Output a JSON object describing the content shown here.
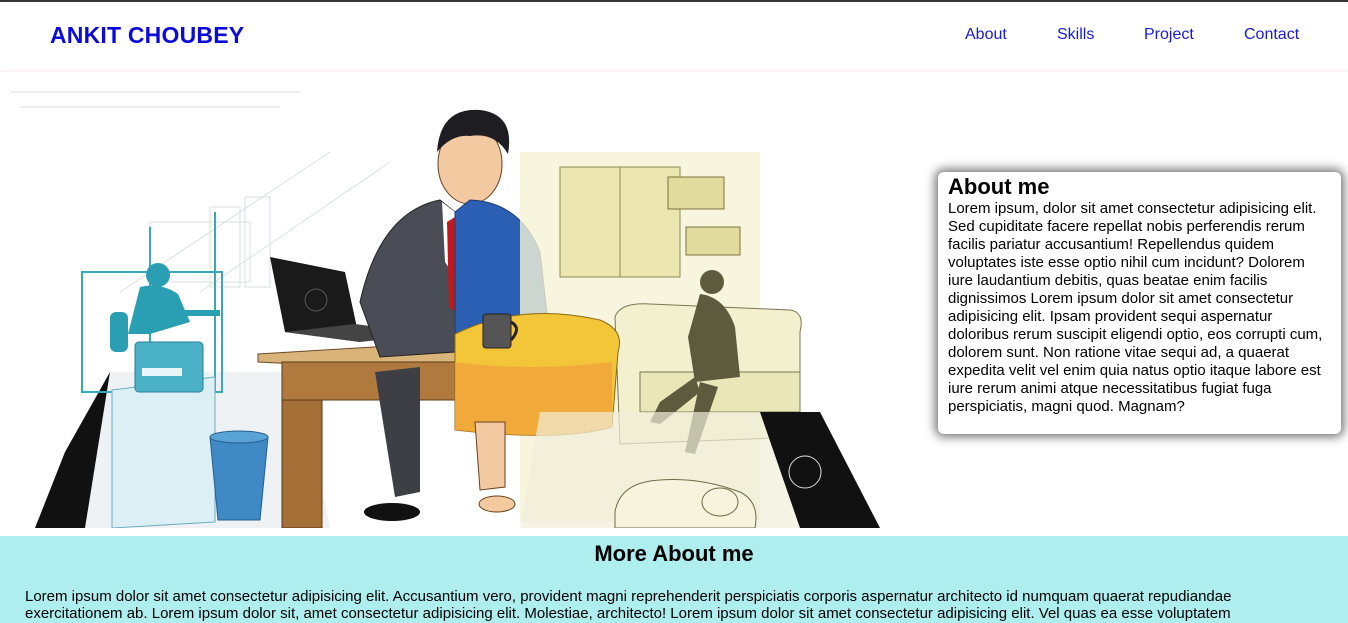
{
  "header": {
    "brand": "ANKIT CHOUBEY",
    "nav": [
      "About",
      "Skills",
      "Project",
      "Contact"
    ]
  },
  "about": {
    "title": "About me",
    "text": "Lorem ipsum, dolor sit amet consectetur adipisicing elit. Sed cupiditate facere repellat nobis perferendis rerum facilis pariatur accusantium! Repellendus quidem voluptates iste esse optio nihil cum incidunt? Dolorem iure laudantium debitis, quas beatae enim facilis dignissimos Lorem ipsum dolor sit amet consectetur adipisicing elit. Ipsam provident sequi aspernatur doloribus rerum suscipit eligendi optio, eos corrupti cum, dolorem sunt. Non ratione vitae sequi ad, a quaerat expedita velit vel enim quia natus optio itaque labore est iure rerum animi atque necessitatibus fugiat fuga perspiciatis, magni quod. Magnam?"
  },
  "more": {
    "title": "More About me",
    "text": "Lorem ipsum dolor sit amet consectetur adipisicing elit. Accusantium vero, provident magni reprehenderit perspiciatis corporis aspernatur architecto id numquam quaerat repudiandae exercitationem ab. Lorem ipsum dolor sit, amet consectetur adipisicing elit. Molestiae, architecto! Lorem ipsum dolor sit amet consectetur adipisicing elit. Vel quas ea esse voluptatem"
  },
  "colors": {
    "brand": "#0b0bd9",
    "nav_link": "#1a1ad6",
    "more_bg": "#afeeee"
  }
}
